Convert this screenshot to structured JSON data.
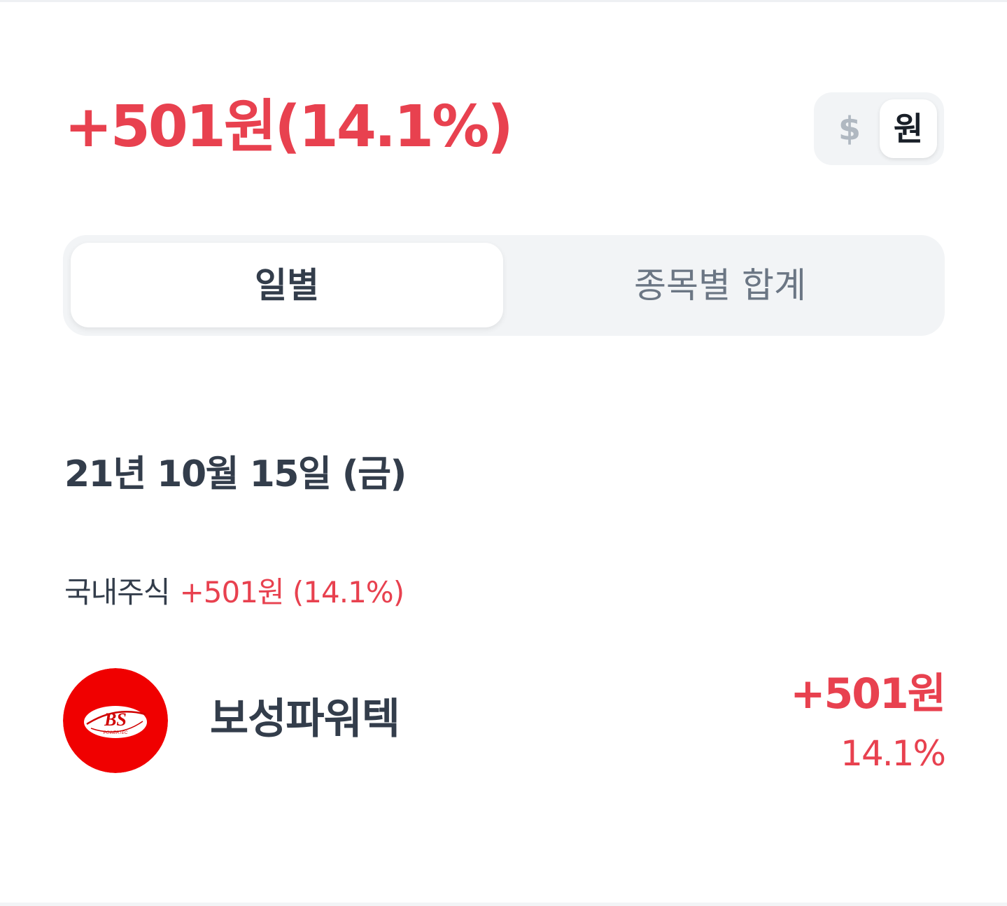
{
  "colors": {
    "rise": "#e8414f",
    "text_primary": "#333d4b",
    "text_dark": "#191f28",
    "text_secondary": "#6b7684",
    "muted": "#b0b8c1",
    "logo_red": "#f00000"
  },
  "header": {
    "total_change": "+501원(14.1%)"
  },
  "currency_toggle": {
    "dollar_label": "$",
    "won_label": "원",
    "selected": "원"
  },
  "tabs": [
    {
      "label": "일별",
      "selected": true
    },
    {
      "label": "종목별 합계",
      "selected": false
    }
  ],
  "day": {
    "date": "21년 10월 15일 (금)",
    "section": {
      "label": "국내주식",
      "change": "+501원 (14.1%)"
    },
    "stocks": [
      {
        "name": "보성파워텍",
        "logo_text": "BS",
        "logo_subtext": "POWERTEC",
        "logo_icon": "bosung-powertec-logo",
        "change": "+501원",
        "rate": "14.1%"
      }
    ]
  }
}
